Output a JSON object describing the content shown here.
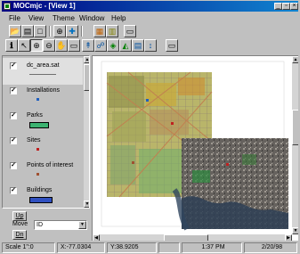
{
  "window": {
    "title": "MOCmjc - [View 1]"
  },
  "menu": {
    "items": [
      "File",
      "View",
      "Theme",
      "Window",
      "Help"
    ]
  },
  "legend": {
    "layers": [
      {
        "name": "dc_area.sat",
        "checked": true,
        "symbol": "line",
        "color": "#707070"
      },
      {
        "name": "Installations",
        "checked": true,
        "symbol": "point",
        "color": "#2060c0"
      },
      {
        "name": "Parks",
        "checked": true,
        "symbol": "polygon",
        "color": "#3cb371"
      },
      {
        "name": "Sites",
        "checked": true,
        "symbol": "point",
        "color": "#c02020"
      },
      {
        "name": "Points of interest",
        "checked": true,
        "symbol": "point",
        "color": "#a05030"
      },
      {
        "name": "Buildings",
        "checked": true,
        "symbol": "polygon",
        "color": "#3050c0"
      }
    ],
    "check_glyph": "✓"
  },
  "move_controls": {
    "up_label": "Up",
    "move_label": "Move",
    "dn_label": "Dn",
    "combo_value": "ID"
  },
  "toolbar_icons": {
    "row1": [
      "open-icon",
      "save-icon",
      "print-icon",
      "add-theme-icon",
      "add-layer-icon",
      "layout-icon",
      "window-icon"
    ],
    "row2": [
      "info-icon",
      "select-icon",
      "zoom-in-icon",
      "zoom-out-icon",
      "pan-icon",
      "full-extent-icon",
      "identify-icon",
      "find-icon",
      "query-icon",
      "chart-icon",
      "table-icon",
      "label-icon",
      "layout-tool-icon"
    ]
  },
  "status": {
    "scale": "Scale 1\":0",
    "x": "X:-77.0304",
    "y": "Y:38.9205",
    "time": "1:37 PM",
    "date": "2/20/98"
  },
  "colors": {
    "titlebar": "#000080",
    "chrome": "#c0c0c0",
    "park": "#3cb371",
    "building": "#3050c0"
  }
}
